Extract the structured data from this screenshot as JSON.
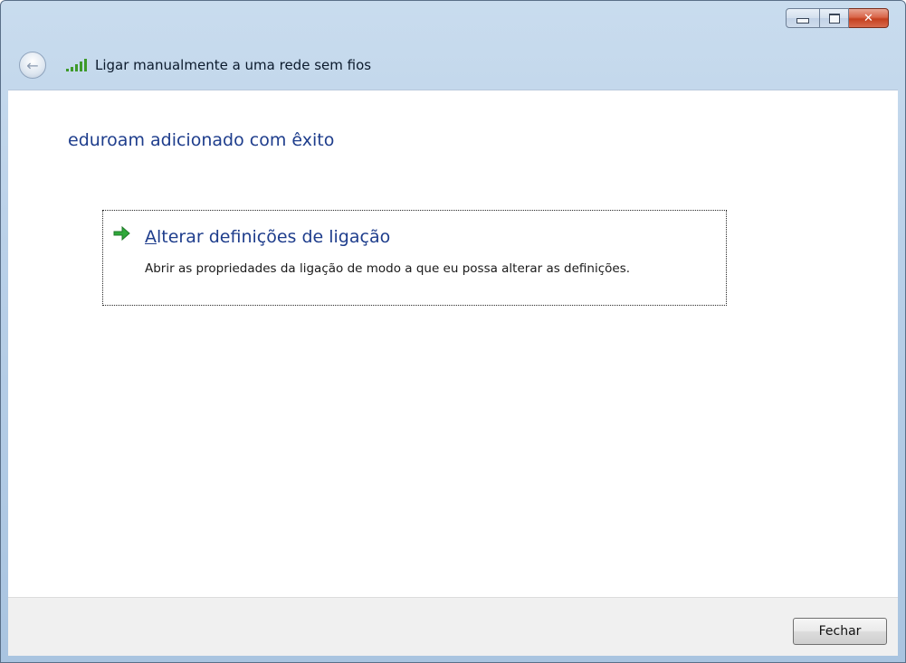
{
  "window": {
    "caption_buttons": {
      "minimize_icon": "minimize-icon",
      "maximize_icon": "maximize-icon",
      "close_icon": "close-x-icon",
      "close_glyph": "✕"
    }
  },
  "header": {
    "back_icon": "back-arrow-icon",
    "back_glyph": "←",
    "network_icon": "wireless-signal-icon",
    "title": "Ligar manualmente a uma rede sem fios"
  },
  "main": {
    "page_title": "eduroam adicionado com êxito",
    "command_link": {
      "icon": "green-arrow-icon",
      "title_accel": "A",
      "title_rest": "lterar definições de ligação",
      "description": "Abrir as propriedades da ligação de modo a que eu possa alterar as definições."
    }
  },
  "footer": {
    "close_label": "Fechar"
  },
  "colors": {
    "frame": "#b9d0e8",
    "title_blue": "#1e3d8c",
    "signal_green": "#3e9a2a",
    "close_red": "#c4401f"
  }
}
